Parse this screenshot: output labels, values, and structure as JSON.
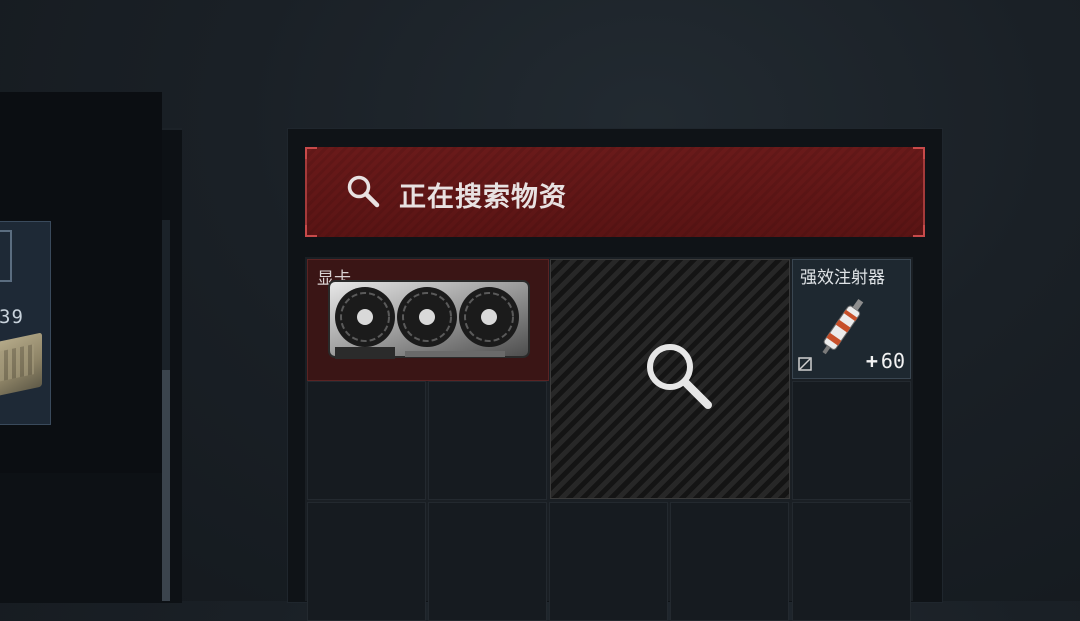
{
  "search_bar": {
    "status_text": "正在搜索物资",
    "icon": "search-icon"
  },
  "left_panel": {
    "partial_count": "39"
  },
  "items": [
    {
      "name": "显卡",
      "icon": "graphics-card-icon"
    },
    {
      "name": "强效注射器",
      "icon": "syringe-icon",
      "count": "60",
      "count_prefix": "+"
    }
  ],
  "searching_slot": {
    "icon": "magnifier-icon"
  },
  "colors": {
    "search_bar_bg": "#5e1717",
    "accent_red": "#c84a4a",
    "item_highlight": "#3a1515",
    "panel_bg": "#0f1317"
  }
}
